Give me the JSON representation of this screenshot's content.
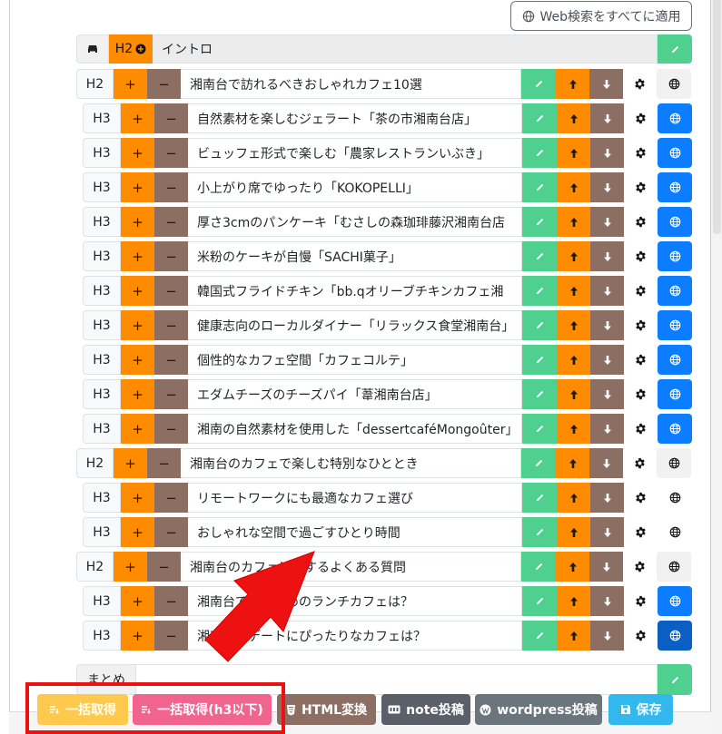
{
  "web_apply_button": "Web検索をすべてに適用",
  "intro": {
    "level": "H2",
    "title": "イントロ"
  },
  "headings": [
    {
      "level": "H2",
      "title": "湘南台で訪れるべきおしゃれカフェ10選",
      "globe": "plain"
    },
    {
      "level": "H3",
      "title": "自然素材を楽しむジェラート「茶の市湘南台店」",
      "globe": "blue"
    },
    {
      "level": "H3",
      "title": "ビュッフェ形式で楽しむ「農家レストランいぶき」",
      "globe": "blue"
    },
    {
      "level": "H3",
      "title": "小上がり席でゆったり「KOKOPELLI」",
      "globe": "blue"
    },
    {
      "level": "H3",
      "title": "厚さ3cmのパンケーキ「むさしの森珈琲藤沢湘南台店",
      "globe": "blue"
    },
    {
      "level": "H3",
      "title": "米粉のケーキが自慢「SACHI菓子」",
      "globe": "blue"
    },
    {
      "level": "H3",
      "title": "韓国式フライドチキン「bb.qオリーブチキンカフェ湘",
      "globe": "blue"
    },
    {
      "level": "H3",
      "title": "健康志向のローカルダイナー「リラックス食堂湘南台」",
      "globe": "blue"
    },
    {
      "level": "H3",
      "title": "個性的なカフェ空間「カフェコルテ」",
      "globe": "blue"
    },
    {
      "level": "H3",
      "title": "エダムチーズのチーズパイ「葦湘南台店」",
      "globe": "blue"
    },
    {
      "level": "H3",
      "title": "湘南の自然素材を使用した「dessertcaféMongoûter」",
      "globe": "blue"
    },
    {
      "level": "H2",
      "title": "湘南台のカフェで楽しむ特別なひととき",
      "globe": "plain"
    },
    {
      "level": "H3",
      "title": "リモートワークにも最適なカフェ選び",
      "globe": "plain"
    },
    {
      "level": "H3",
      "title": "おしゃれな空間で過ごすひとり時間",
      "globe": "plain"
    },
    {
      "level": "H2",
      "title": "湘南台のカフェに関するよくある質問",
      "globe": "plain"
    },
    {
      "level": "H3",
      "title": "湘南台でおすすめのランチカフェは？",
      "globe": "blue"
    },
    {
      "level": "H3",
      "title": "湘南台でデートにぴったりなカフェは？",
      "globe": "dark"
    }
  ],
  "summary_label": "まとめ",
  "buttons": {
    "bulk_fetch": "一括取得",
    "bulk_fetch_h3": "一括取得(h3以下)",
    "html_convert": "HTML変換",
    "note_post": "note投稿",
    "wordpress_post": "wordpress投稿",
    "save": "保存"
  },
  "colors": {
    "orange": "#ff8c00",
    "brown": "#8d6e63",
    "green": "#4fd08f",
    "blue": "#0d7dff",
    "highlight": "#ee1111"
  },
  "icons": {
    "up": "arrow-up-icon",
    "down": "arrow-down-icon",
    "edit": "pencil-icon",
    "settings": "gear-icon",
    "web": "globe-icon"
  }
}
